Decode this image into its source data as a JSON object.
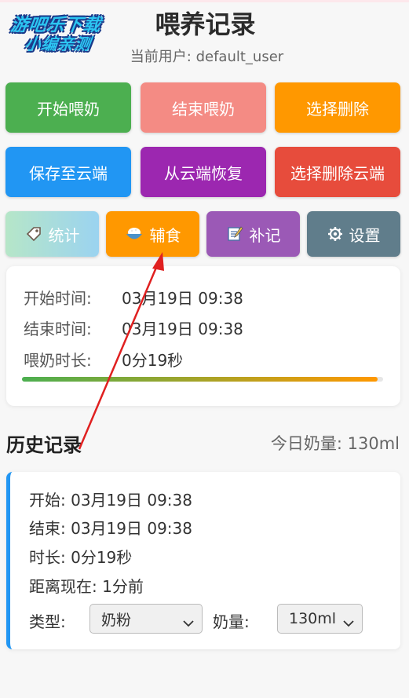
{
  "watermark": {
    "line1": "游吧乐下载",
    "line2": "小编亲测"
  },
  "header": {
    "title": "喂养记录",
    "user_label": "当前用户: default_user"
  },
  "actions_row1": [
    {
      "label": "开始喂奶",
      "color": "#4caf50"
    },
    {
      "label": "结束喂奶",
      "color": "#f48b84"
    },
    {
      "label": "选择删除",
      "color": "#ff9800"
    }
  ],
  "actions_row2": [
    {
      "label": "保存至云端",
      "color": "#2196f3"
    },
    {
      "label": "从云端恢复",
      "color": "#9c27b0"
    },
    {
      "label": "选择删除云端",
      "color": "#f44336"
    }
  ],
  "tabs": [
    {
      "label": "统计",
      "icon": "tag-icon",
      "color": "#a3dcec"
    },
    {
      "label": "辅食",
      "icon": "rice-bowl-icon",
      "color": "#ff9800"
    },
    {
      "label": "补记",
      "icon": "memo-icon",
      "color": "#9b59b6"
    },
    {
      "label": "设置",
      "icon": "gear-icon",
      "color": "#607d8b"
    }
  ],
  "session": {
    "start_label": "开始时间:",
    "start_value": "03月19日 09:38",
    "end_label": "结束时间:",
    "end_value": "03月19日 09:38",
    "duration_label": "喂奶时长:",
    "duration_value": "0分19秒",
    "progress_fraction": 0.985
  },
  "history": {
    "title": "历史记录",
    "today_total": "今日奶量: 130ml",
    "records": [
      {
        "start": "开始: 03月19日 09:38",
        "end": "结束: 03月19日 09:38",
        "duration": "时长: 0分19秒",
        "ago": "距离现在: 1分前",
        "type_label": "类型:",
        "type_value": "奶粉",
        "amount_label": "奶量:",
        "amount_value": "130ml"
      }
    ]
  },
  "annotation": {
    "type": "red-arrow",
    "target": "辅食",
    "color": "#e02020"
  }
}
